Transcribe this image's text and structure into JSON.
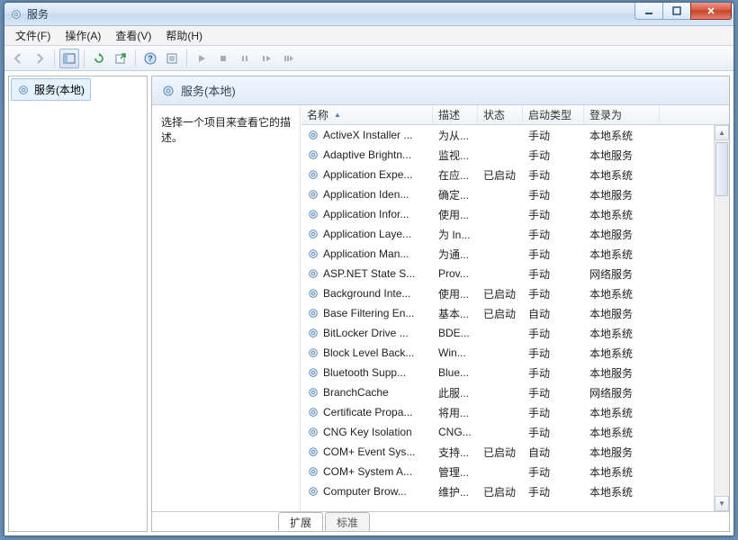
{
  "window": {
    "title": "服务"
  },
  "menu": {
    "file": "文件(F)",
    "action": "操作(A)",
    "view": "查看(V)",
    "help": "帮助(H)"
  },
  "tree": {
    "root": "服务(本地)"
  },
  "pane": {
    "heading": "服务(本地)",
    "description_prompt": "选择一个项目来查看它的描述。"
  },
  "columns": {
    "name": "名称",
    "desc": "描述",
    "status": "状态",
    "startup": "启动类型",
    "logon": "登录为"
  },
  "tabs": {
    "extended": "扩展",
    "standard": "标准"
  },
  "services": [
    {
      "name": "ActiveX Installer ...",
      "desc": "为从...",
      "status": "",
      "startup": "手动",
      "logon": "本地系统"
    },
    {
      "name": "Adaptive Brightn...",
      "desc": "监视...",
      "status": "",
      "startup": "手动",
      "logon": "本地服务"
    },
    {
      "name": "Application Expe...",
      "desc": "在应...",
      "status": "已启动",
      "startup": "手动",
      "logon": "本地系统"
    },
    {
      "name": "Application Iden...",
      "desc": "确定...",
      "status": "",
      "startup": "手动",
      "logon": "本地服务"
    },
    {
      "name": "Application Infor...",
      "desc": "使用...",
      "status": "",
      "startup": "手动",
      "logon": "本地系统"
    },
    {
      "name": "Application Laye...",
      "desc": "为 In...",
      "status": "",
      "startup": "手动",
      "logon": "本地服务"
    },
    {
      "name": "Application Man...",
      "desc": "为通...",
      "status": "",
      "startup": "手动",
      "logon": "本地系统"
    },
    {
      "name": "ASP.NET State S...",
      "desc": "Prov...",
      "status": "",
      "startup": "手动",
      "logon": "网络服务"
    },
    {
      "name": "Background Inte...",
      "desc": "使用...",
      "status": "已启动",
      "startup": "手动",
      "logon": "本地系统"
    },
    {
      "name": "Base Filtering En...",
      "desc": "基本...",
      "status": "已启动",
      "startup": "自动",
      "logon": "本地服务"
    },
    {
      "name": "BitLocker Drive ...",
      "desc": "BDE...",
      "status": "",
      "startup": "手动",
      "logon": "本地系统"
    },
    {
      "name": "Block Level Back...",
      "desc": "Win...",
      "status": "",
      "startup": "手动",
      "logon": "本地系统"
    },
    {
      "name": "Bluetooth Supp...",
      "desc": "Blue...",
      "status": "",
      "startup": "手动",
      "logon": "本地服务"
    },
    {
      "name": "BranchCache",
      "desc": "此服...",
      "status": "",
      "startup": "手动",
      "logon": "网络服务"
    },
    {
      "name": "Certificate Propa...",
      "desc": "将用...",
      "status": "",
      "startup": "手动",
      "logon": "本地系统"
    },
    {
      "name": "CNG Key Isolation",
      "desc": "CNG...",
      "status": "",
      "startup": "手动",
      "logon": "本地系统"
    },
    {
      "name": "COM+ Event Sys...",
      "desc": "支持...",
      "status": "已启动",
      "startup": "自动",
      "logon": "本地服务"
    },
    {
      "name": "COM+ System A...",
      "desc": "管理...",
      "status": "",
      "startup": "手动",
      "logon": "本地系统"
    },
    {
      "name": "Computer Brow...",
      "desc": "维护...",
      "status": "已启动",
      "startup": "手动",
      "logon": "本地系统"
    }
  ]
}
